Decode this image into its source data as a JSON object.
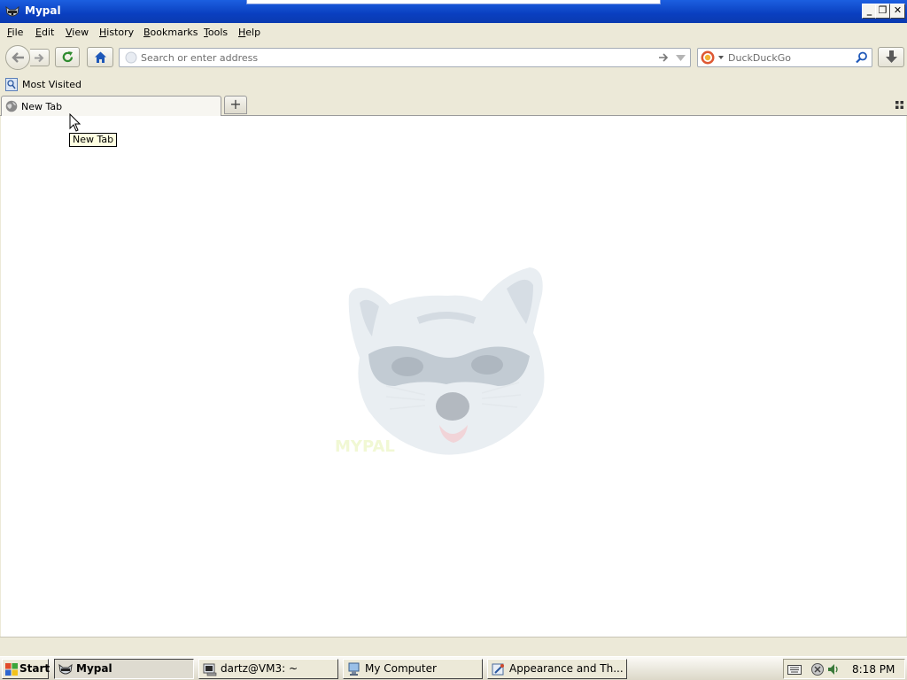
{
  "window": {
    "title": "Mypal",
    "minimize_label": "_",
    "restore_label": "❐",
    "close_label": "✕"
  },
  "menu": {
    "items": [
      {
        "label_u": "F",
        "label_rest": "ile"
      },
      {
        "label_u": "E",
        "label_rest": "dit"
      },
      {
        "label_u": "V",
        "label_rest": "iew"
      },
      {
        "label_u": "H",
        "label_rest": "istory"
      },
      {
        "label_u": "B",
        "label_rest": "ookmarks"
      },
      {
        "label_u": "T",
        "label_rest": "ools"
      },
      {
        "label_u": "H",
        "label_rest": "elp"
      }
    ]
  },
  "navigation": {
    "url_placeholder": "Search or enter address",
    "search_placeholder": "DuckDuckGo"
  },
  "bookmarks": {
    "most_visited": "Most Visited"
  },
  "tabs": {
    "active_tab_label": "New Tab",
    "new_tab_button": "+"
  },
  "tooltip": {
    "text": "New Tab"
  },
  "content": {
    "logo_text": "MYPAL"
  },
  "taskbar": {
    "start_label": "Start",
    "tasks": [
      {
        "label": "Mypal",
        "icon": "raccoon-icon",
        "active": true
      },
      {
        "label": "dartz@VM3: ~",
        "icon": "terminal-icon",
        "active": false
      },
      {
        "label": "My Computer",
        "icon": "computer-icon",
        "active": false
      },
      {
        "label": "Appearance and Th...",
        "icon": "control-panel-icon",
        "active": false
      }
    ],
    "clock": "8:18 PM"
  },
  "colors": {
    "titlebar": "#0a3fc0",
    "chrome": "#ece9d8",
    "accent_home": "#1d57b8",
    "accent_reload": "#2e8b2e"
  }
}
